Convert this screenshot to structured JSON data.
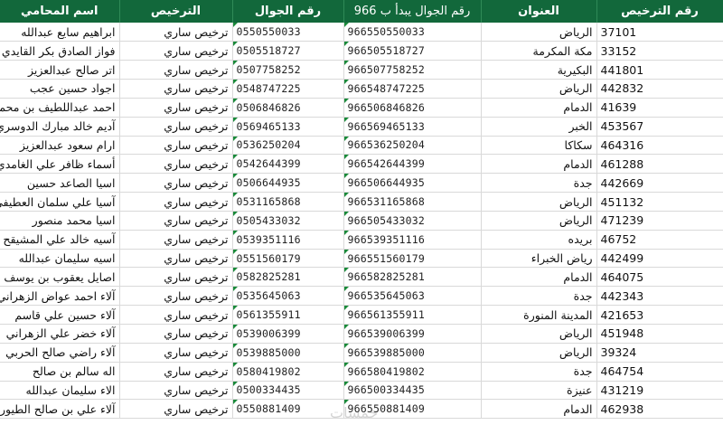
{
  "headers": {
    "name": "اسم المحامي",
    "license": "الترخيص",
    "mobile": "رقم الجوال",
    "mobile966": "رقم الجوال يبدأ ب 966",
    "address": "العنوان",
    "license_no": "رقم الترخيص"
  },
  "watermark": "خمسات",
  "rows": [
    {
      "name": "ابراهيم سايع عبدالله",
      "license": "ترخيص ساري",
      "mobile": "0550550033",
      "mobile966": "966550550033",
      "address": "الرياض",
      "license_no": "37101"
    },
    {
      "name": "فواز الصادق بكر القايدي",
      "license": "ترخيص ساري",
      "mobile": "0505518727",
      "mobile966": "966505518727",
      "address": "مكة المكرمة",
      "license_no": "33152"
    },
    {
      "name": "اتر صالح عبدالعزيز",
      "license": "ترخيص ساري",
      "mobile": "0507758252",
      "mobile966": "966507758252",
      "address": "البكيرية",
      "license_no": "441801"
    },
    {
      "name": "اجواد حسين عجب",
      "license": "ترخيص ساري",
      "mobile": "0548747225",
      "mobile966": "966548747225",
      "address": "الرياض",
      "license_no": "442832"
    },
    {
      "name": "احمد عبداللطيف بن محمد",
      "license": "ترخيص ساري",
      "mobile": "0506846826",
      "mobile966": "966506846826",
      "address": "الدمام",
      "license_no": "41639"
    },
    {
      "name": "آديم خالد مبارك الدوسري",
      "license": "ترخيص ساري",
      "mobile": "0569465133",
      "mobile966": "966569465133",
      "address": "الخبر",
      "license_no": "453567"
    },
    {
      "name": "ارام سعود عبدالعزيز",
      "license": "ترخيص ساري",
      "mobile": "0536250204",
      "mobile966": "966536250204",
      "address": "سكاكا",
      "license_no": "464316"
    },
    {
      "name": "أسماء ظافر علي الغامدي",
      "license": "ترخيص ساري",
      "mobile": "0542644399",
      "mobile966": "966542644399",
      "address": "الدمام",
      "license_no": "461288"
    },
    {
      "name": "اسيا الصاعد حسين",
      "license": "ترخيص ساري",
      "mobile": "0506644935",
      "mobile966": "966506644935",
      "address": "جدة",
      "license_no": "442669"
    },
    {
      "name": "آسيا علي سلمان العطيفي",
      "license": "ترخيص ساري",
      "mobile": "0531165868",
      "mobile966": "966531165868",
      "address": "الرياض",
      "license_no": "451132"
    },
    {
      "name": "اسيا محمد منصور",
      "license": "ترخيص ساري",
      "mobile": "0505433032",
      "mobile966": "966505433032",
      "address": "الرياض",
      "license_no": "471239"
    },
    {
      "name": "آسيه خالد علي المشيقح",
      "license": "ترخيص ساري",
      "mobile": "0539351116",
      "mobile966": "966539351116",
      "address": "بريده",
      "license_no": "46752"
    },
    {
      "name": "اسيه سليمان عبدالله",
      "license": "ترخيص ساري",
      "mobile": "0551560179",
      "mobile966": "966551560179",
      "address": "رياض الخبراء",
      "license_no": "442499"
    },
    {
      "name": "اصايل يعقوب بن يوسف",
      "license": "ترخيص ساري",
      "mobile": "0582825281",
      "mobile966": "966582825281",
      "address": "الدمام",
      "license_no": "464075"
    },
    {
      "name": "آلاء احمد عواض الزهراني",
      "license": "ترخيص ساري",
      "mobile": "0535645063",
      "mobile966": "966535645063",
      "address": "جدة",
      "license_no": "442343"
    },
    {
      "name": "آلاء حسين علي قاسم",
      "license": "ترخيص ساري",
      "mobile": "0561355911",
      "mobile966": "966561355911",
      "address": "المدينة المنورة",
      "license_no": "421653"
    },
    {
      "name": "آلاء خضر علي الزهراني",
      "license": "ترخيص ساري",
      "mobile": "0539006399",
      "mobile966": "966539006399",
      "address": "الرياض",
      "license_no": "451948"
    },
    {
      "name": "آلاء راضي صالح الحربي",
      "license": "ترخيص ساري",
      "mobile": "0539885000",
      "mobile966": "966539885000",
      "address": "الرياض",
      "license_no": "39324"
    },
    {
      "name": "اله سالم بن صالح",
      "license": "ترخيص ساري",
      "mobile": "0580419802",
      "mobile966": "966580419802",
      "address": "جدة",
      "license_no": "464754"
    },
    {
      "name": "الاء سليمان عبدالله",
      "license": "ترخيص ساري",
      "mobile": "0500334435",
      "mobile966": "966500334435",
      "address": "عنيزة",
      "license_no": "431219"
    },
    {
      "name": "آلاء علي بن صالح الطيور",
      "license": "ترخيص ساري",
      "mobile": "0550881409",
      "mobile966": "966550881409",
      "address": "الدمام",
      "license_no": "462938"
    }
  ]
}
